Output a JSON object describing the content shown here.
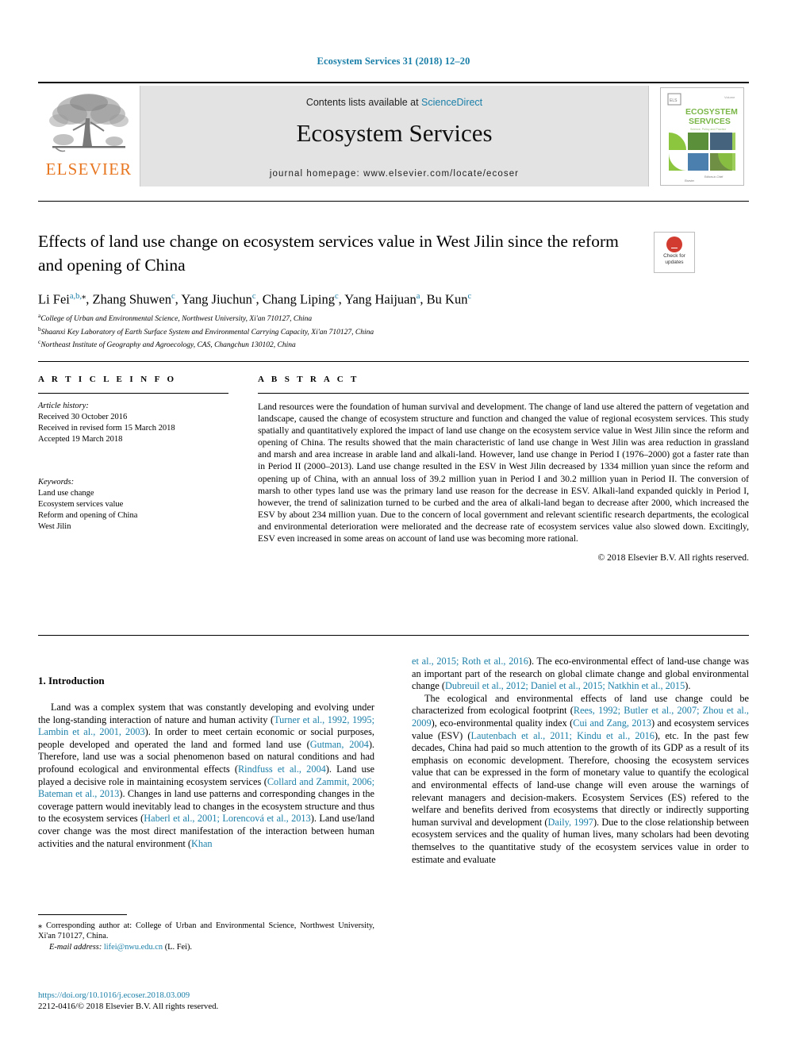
{
  "running_head": "Ecosystem Services 31 (2018) 12–20",
  "masthead": {
    "contents_prefix": "Contents lists available at ",
    "contents_link": "ScienceDirect",
    "journal_name": "Ecosystem Services",
    "homepage": "journal homepage: www.elsevier.com/locate/ecoser",
    "publisher_wordmark": "ELSEVIER",
    "cover_title_line1": "ECOSYSTEM",
    "cover_title_line2": "SERVICES"
  },
  "crossmark": {
    "line1": "Check for",
    "line2": "updates"
  },
  "title": "Effects of land use change on ecosystem services value in West Jilin since the reform and opening of China",
  "authors": [
    {
      "name": "Li Fei",
      "sup": "a,b,",
      "star": true
    },
    {
      "name": "Zhang Shuwen",
      "sup": "c"
    },
    {
      "name": "Yang Jiuchun",
      "sup": "c"
    },
    {
      "name": "Chang Liping",
      "sup": "c"
    },
    {
      "name": "Yang Haijuan",
      "sup": "a"
    },
    {
      "name": "Bu Kun",
      "sup": "c"
    }
  ],
  "affiliations": [
    {
      "mark": "a",
      "text": "College of Urban and Environmental Science, Northwest University, Xi'an 710127, China"
    },
    {
      "mark": "b",
      "text": "Shaanxi Key Laboratory of Earth Surface System and Environmental Carrying Capacity, Xi'an 710127, China"
    },
    {
      "mark": "c",
      "text": "Northeast Institute of Geography and Agroecology, CAS, Changchun 130102, China"
    }
  ],
  "article_info": {
    "heading": "A R T I C L E  I N F O",
    "history_label": "Article history:",
    "history": [
      "Received 30 October 2016",
      "Received in revised form 15 March 2018",
      "Accepted 19 March 2018"
    ],
    "keywords_label": "Keywords:",
    "keywords": [
      "Land use change",
      "Ecosystem services value",
      "Reform and opening of China",
      "West Jilin"
    ]
  },
  "abstract": {
    "heading": "A B S T R A C T",
    "text": "Land resources were the foundation of human survival and development. The change of land use altered the pattern of vegetation and landscape, caused the change of ecosystem structure and function and changed the value of regional ecosystem services. This study spatially and quantitatively explored the impact of land use change on the ecosystem service value in West Jilin since the reform and opening of China. The results showed that the main characteristic of land use change in West Jilin was area reduction in grassland and marsh and area increase in arable land and alkali-land. However, land use change in Period I (1976–2000) got a faster rate than in Period II (2000–2013). Land use change resulted in the ESV in West Jilin decreased by 1334 million yuan since the reform and opening up of China, with an annual loss of 39.2 million yuan in Period I and 30.2 million yuan in Period II. The conversion of marsh to other types land use was the primary land use reason for the decrease in ESV. Alkali-land expanded quickly in Period I, however, the trend of salinization turned to be curbed and the area of alkali-land began to decrease after 2000, which increased the ESV by about 234 million yuan. Due to the concern of local government and relevant scientific research departments, the ecological and environmental deterioration were meliorated and the decrease rate of ecosystem services value also slowed down. Excitingly, ESV even increased in some areas on account of land use was becoming more rational.",
    "copyright": "© 2018 Elsevier B.V. All rights reserved."
  },
  "body": {
    "section_heading": "1. Introduction",
    "left_paragraphs": [
      {
        "segments": [
          {
            "t": "Land was a complex system that was constantly developing and evolving under the long-standing interaction of nature and human activity (",
            "ref": false
          },
          {
            "t": "Turner et al., 1992, 1995; Lambin et al., 2001, 2003",
            "ref": true
          },
          {
            "t": "). In order to meet certain economic or social purposes, people developed and operated the land and formed land use (",
            "ref": false
          },
          {
            "t": "Gutman, 2004",
            "ref": true
          },
          {
            "t": "). Therefore, land use was a social phenomenon based on natural conditions and had profound ecological and environmental effects (",
            "ref": false
          },
          {
            "t": "Rindfuss et al., 2004",
            "ref": true
          },
          {
            "t": "). Land use played a decisive role in maintaining ecosystem services (",
            "ref": false
          },
          {
            "t": "Collard and Zammit, 2006; Bateman et al., 2013",
            "ref": true
          },
          {
            "t": "). Changes in land use patterns and corresponding changes in the coverage pattern would inevitably lead to changes in the ecosystem structure and thus to the ecosystem services (",
            "ref": false
          },
          {
            "t": "Haberl et al., 2001; Lorencová et al., 2013",
            "ref": true
          },
          {
            "t": "). Land use/land cover change was the most direct manifestation of the interaction between human activities and the natural environment (",
            "ref": false
          },
          {
            "t": "Khan",
            "ref": true
          }
        ]
      }
    ],
    "right_paragraphs": [
      {
        "indent": false,
        "segments": [
          {
            "t": "et al., 2015; Roth et al., 2016",
            "ref": true
          },
          {
            "t": "). The eco-environmental effect of land-use change was an important part of the research on global climate change and global environmental change (",
            "ref": false
          },
          {
            "t": "Dubreuil et al., 2012; Daniel et al., 2015; Natkhin et al., 2015",
            "ref": true
          },
          {
            "t": ").",
            "ref": false
          }
        ]
      },
      {
        "indent": true,
        "segments": [
          {
            "t": "The ecological and environmental effects of land use change could be characterized from ecological footprint (",
            "ref": false
          },
          {
            "t": "Rees, 1992; Butler et al., 2007; Zhou et al., 2009",
            "ref": true
          },
          {
            "t": "), eco-environmental quality index (",
            "ref": false
          },
          {
            "t": "Cui and Zang, 2013",
            "ref": true
          },
          {
            "t": ") and ecosystem services value (ESV) (",
            "ref": false
          },
          {
            "t": "Lautenbach et al., 2011; Kindu et al., 2016",
            "ref": true
          },
          {
            "t": "), etc. In the past few decades, China had paid so much attention to the growth of its GDP as a result of its emphasis on economic development. Therefore, choosing the ecosystem services value that can be expressed in the form of monetary value to quantify the ecological and environmental effects of land-use change will even arouse the warnings of relevant managers and decision-makers. Ecosystem Services (ES) refered to the welfare and benefits derived from ecosystems that directly or indirectly supporting human survival and development (",
            "ref": false
          },
          {
            "t": "Daily, 1997",
            "ref": true
          },
          {
            "t": "). Due to the close relationship between ecosystem services and the quality of human lives, many scholars had been devoting themselves to the quantitative study of the ecosystem services value in order to estimate and evaluate",
            "ref": false
          }
        ]
      }
    ]
  },
  "footnotes": {
    "corresponding_mark": "⁎",
    "corresponding_text": " Corresponding author at: College of Urban and Environmental Science, Northwest University, Xi'an 710127, China.",
    "email_label": "E-mail address:",
    "email": "lifei@nwu.edu.cn",
    "email_suffix": " (L. Fei).",
    "doi": "https://doi.org/10.1016/j.ecoser.2018.03.009",
    "issn_line": "2212-0416/© 2018 Elsevier B.V. All rights reserved."
  },
  "colors": {
    "link": "#1a7fa8",
    "elsevier_orange": "#E87722",
    "masthead_bg": "#e3e3e3"
  }
}
